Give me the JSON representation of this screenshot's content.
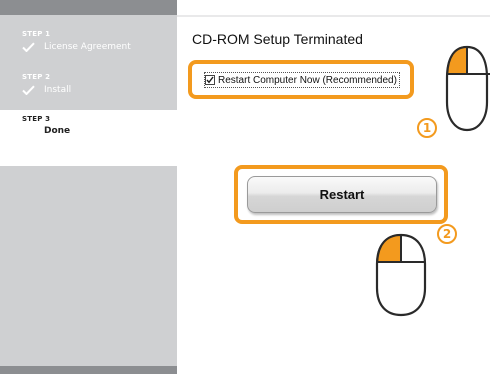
{
  "sidebar": {
    "steps": [
      {
        "number": "STEP 1",
        "label": "License Agreement",
        "status": "completed"
      },
      {
        "number": "STEP 2",
        "label": "Install",
        "status": "completed"
      },
      {
        "number": "STEP 3",
        "label": "Done",
        "status": "active"
      }
    ]
  },
  "main": {
    "title": "CD-ROM Setup Terminated",
    "restart_checkbox": {
      "label": "Restart Computer Now (Recommended)",
      "checked": true
    },
    "restart_button_label": "Restart"
  },
  "annotations": {
    "step_1_marker": "1",
    "step_2_marker": "2",
    "icon_1": "mouse-left-click-icon",
    "icon_2": "mouse-left-click-icon",
    "accent_color": "#f39a1e"
  }
}
